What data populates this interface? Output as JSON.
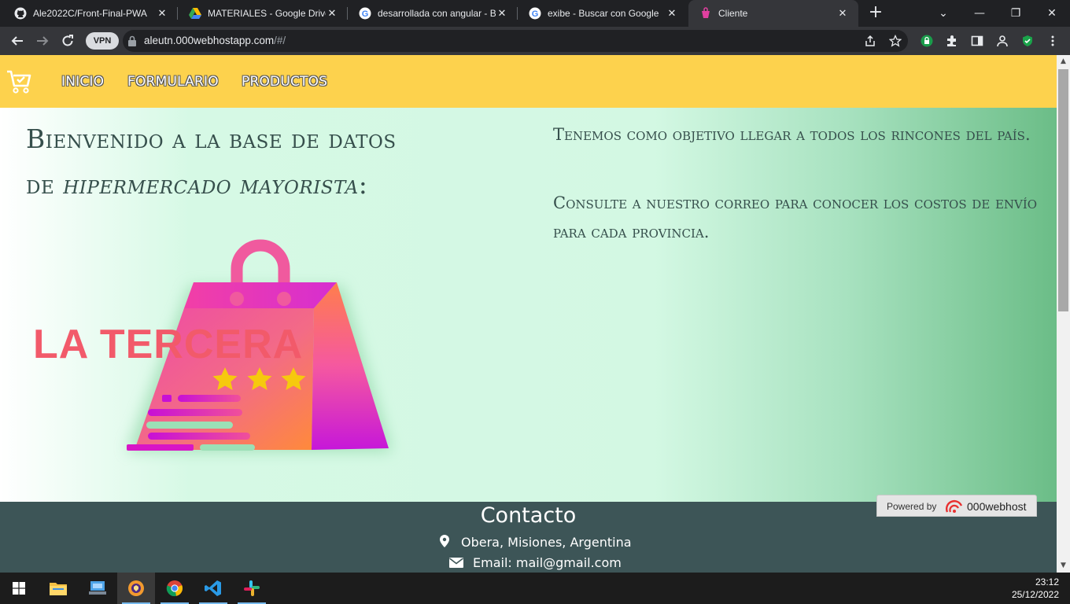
{
  "browser": {
    "tabs": [
      {
        "title": "Ale2022C/Front-Final-PWA",
        "icon": "github-icon"
      },
      {
        "title": "MATERIALES - Google Drive",
        "icon": "google-drive-icon"
      },
      {
        "title": "desarrollada con angular - Bu",
        "icon": "google-icon"
      },
      {
        "title": "exibe - Buscar con Google",
        "icon": "google-icon"
      },
      {
        "title": "Cliente",
        "icon": "site-favicon"
      }
    ],
    "vpn_label": "VPN",
    "url_host": "aleutn.000webhostapp.com",
    "url_path": "/#/"
  },
  "site": {
    "nav": {
      "items": [
        "INICIO",
        "FORMULARIO",
        "PRODUCTOS"
      ]
    },
    "hero": {
      "title_line1": "Bienvenido a la base de datos",
      "title_line2_prefix": "de ",
      "title_line2_em": "hipermercado mayorista",
      "title_line2_suffix": ":",
      "paragraph1": "Tenemos como objetivo llegar a todos los rincones del país.",
      "paragraph2": "Consulte a nuestro correo para conocer los costos de envío para cada provincia.",
      "logo_text": "LA TERCERA"
    },
    "footer": {
      "title": "Contacto",
      "location": "Obera, Misiones, Argentina",
      "email": "Email: mail@gmail.com"
    },
    "badge": {
      "powered_by": "Powered by",
      "brand": "000webhost"
    }
  },
  "taskbar": {
    "time": "23:12",
    "date": "25/12/2022"
  },
  "colors": {
    "navbar": "#fdd24d",
    "footer": "#3d5557",
    "heading": "#364f4c"
  }
}
